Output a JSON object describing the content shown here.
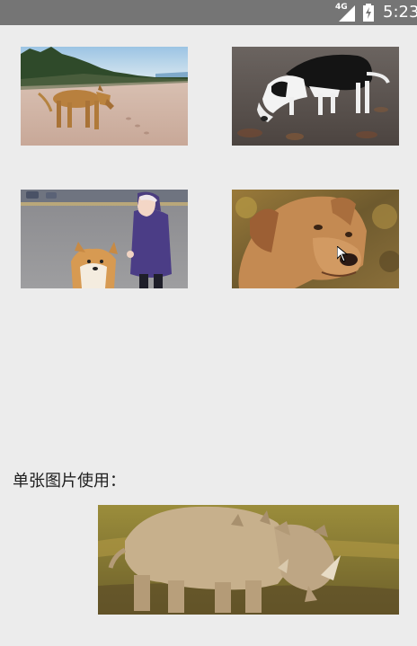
{
  "status_bar": {
    "network": "4G",
    "time": "5:23"
  },
  "grid": [
    {
      "subject": "dog-on-beach"
    },
    {
      "subject": "dog-sniffing-ground"
    },
    {
      "subject": "child-with-corgi"
    },
    {
      "subject": "dog-portrait"
    }
  ],
  "single_image_section": {
    "label": "单张图片使用：",
    "subject": "rhino"
  },
  "colors": {
    "background": "#ececec",
    "status_bar": "#757575"
  }
}
